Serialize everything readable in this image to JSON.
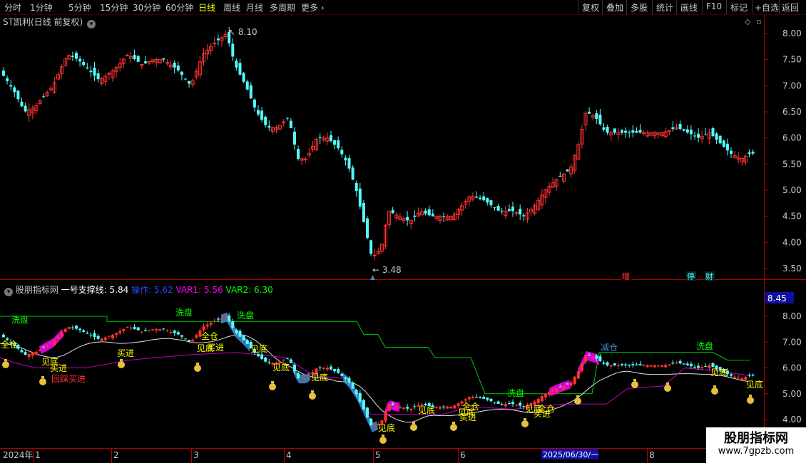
{
  "toolbar": {
    "periods": [
      "分时",
      "1分钟",
      "5分钟",
      "15分钟",
      "30分钟",
      "60分钟",
      "日线",
      "周线",
      "月线",
      "多周期",
      "更多"
    ],
    "active_period": "日线",
    "more_arrow": "›",
    "buttons": [
      "复权",
      "叠加",
      "多股",
      "统计",
      "画线",
      "F10",
      "标记",
      "+自选",
      "返回"
    ]
  },
  "main_chart": {
    "title": "ST凯利(日线 前复权)",
    "high_label": "8.10",
    "low_label": "3.48",
    "y_ticks": [
      "8.00",
      "7.50",
      "7.00",
      "6.50",
      "6.00",
      "5.50",
      "5.00",
      "4.50",
      "4.00",
      "3.50"
    ],
    "event_markers": [
      "增",
      "停",
      "财"
    ]
  },
  "indicator": {
    "name": "股朋指标网",
    "line1_label": "一号支撑线: 5.84",
    "line2_label": "操作: 5.62",
    "line3_label": "VAR1: 5.56",
    "line4_label": "VAR2: 6.30",
    "current_value": "8.45",
    "y_ticks": [
      "8.00",
      "7.00",
      "6.00",
      "5.00",
      "4.00"
    ],
    "signals": {
      "xipan": "洗盘",
      "jiandi": "见底",
      "mairu": "买进",
      "quancang": "全仓",
      "huicai": "回踩买进",
      "jiancang": "减仓"
    }
  },
  "x_axis": {
    "labels": [
      "2024年",
      "1",
      "2",
      "3",
      "4",
      "5",
      "6",
      "2025/06/30/一",
      "8"
    ]
  },
  "colors": {
    "up": "#ff3232",
    "down": "#54fcfc",
    "axis": "#b00000",
    "yellow": "#ffff00",
    "green": "#00ff00",
    "magenta": "#ff00ff",
    "blue": "#3a8fd0"
  },
  "watermark": {
    "name": "股朋指标网",
    "url": "www.7gpzb.com"
  }
}
